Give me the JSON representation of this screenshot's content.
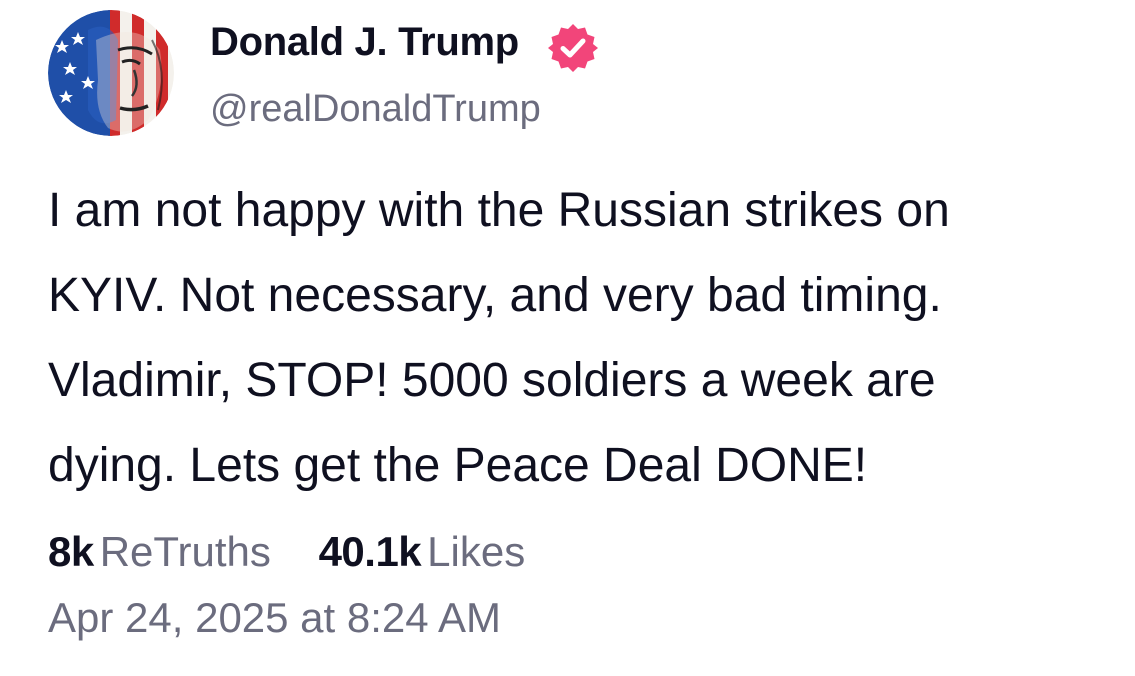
{
  "author": {
    "display_name": "Donald J. Trump",
    "handle": "@realDonaldTrump",
    "verified_icon": "verified-badge-icon",
    "badge_color": "#f2457a"
  },
  "post": {
    "text": "I am not happy with the Russian strikes on\nKYIV. Not necessary, and very bad timing.\nVladimir, STOP! 5000 soldiers a week are\ndying. Lets get the Peace Deal DONE!"
  },
  "stats": {
    "retruths_count": "8k",
    "retruths_label": "ReTruths",
    "likes_count": "40.1k",
    "likes_label": "Likes"
  },
  "timestamp": "Apr 24, 2025 at 8:24 AM"
}
